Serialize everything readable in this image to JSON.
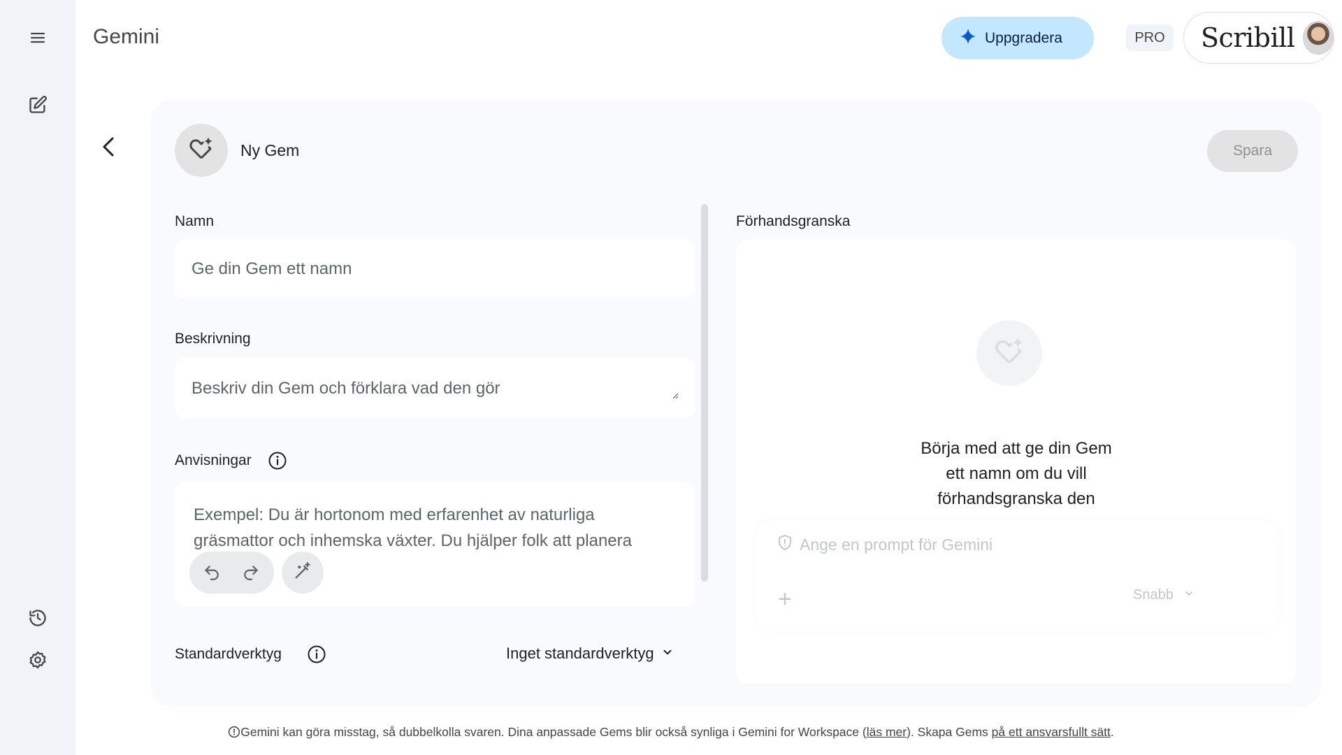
{
  "app": {
    "title": "Gemini"
  },
  "rail": {
    "icons": [
      "menu-icon",
      "new-chat-icon",
      "activity-icon",
      "settings-icon"
    ]
  },
  "header": {
    "upgrade_label": "Uppgradera",
    "pro_badge": "PRO",
    "account_brand": "Scribill"
  },
  "gem": {
    "title": "Ny Gem",
    "save_label": "Spara"
  },
  "form": {
    "name_label": "Namn",
    "name_placeholder": "Ge din Gem ett namn",
    "description_label": "Beskrivning",
    "description_placeholder": "Beskriv din Gem och förklara vad den gör",
    "instructions_label": "Anvisningar",
    "instructions_placeholder": "Exempel: Du är hortonom med erfarenhet av naturliga gräsmattor och inhemska växter. Du hjälper folk att planera",
    "default_tool_label": "Standardverktyg",
    "default_tool_value": "Inget standardverktyg"
  },
  "preview": {
    "label": "Förhandsgranska",
    "message": "Börja med att ge din Gem ett namn om du vill förhandsgranska den",
    "prompt_placeholder": "Ange en prompt för Gemini",
    "model_label": "Snabb"
  },
  "footer": {
    "text_before": "Gemini kan göra misstag, så dubbelkolla svaren. Dina anpassade Gems blir också synliga i Gemini for Workspace (",
    "link1": "läs mer",
    "text_middle": "). Skapa Gems ",
    "link2": "på ett ansvarsfullt sätt",
    "text_after": "."
  },
  "colors": {
    "rail_bg": "#f0f4f9",
    "card_bg": "#f8fafd",
    "upgrade_bg": "#c2e7ff",
    "upgrade_star": "#0b57d0"
  }
}
